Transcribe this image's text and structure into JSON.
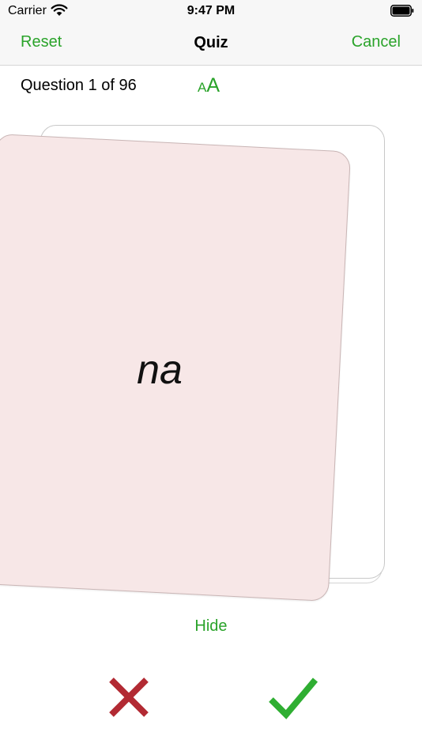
{
  "status_bar": {
    "carrier": "Carrier",
    "time": "9:47 PM"
  },
  "nav": {
    "left_label": "Reset",
    "title": "Quiz",
    "right_label": "Cancel"
  },
  "quiz": {
    "question_label": "Question 1 of 96",
    "font_size_small": "A",
    "font_size_large": "A",
    "card_text": "na",
    "hide_label": "Hide"
  },
  "icons": {
    "wrong": "x-icon",
    "correct": "checkmark-icon",
    "wifi": "wifi-icon",
    "battery": "battery-icon"
  },
  "colors": {
    "accent": "#2aa32a",
    "wrong": "#b22a33",
    "correct": "#2fae32",
    "card_front": "#f7e7e7"
  }
}
